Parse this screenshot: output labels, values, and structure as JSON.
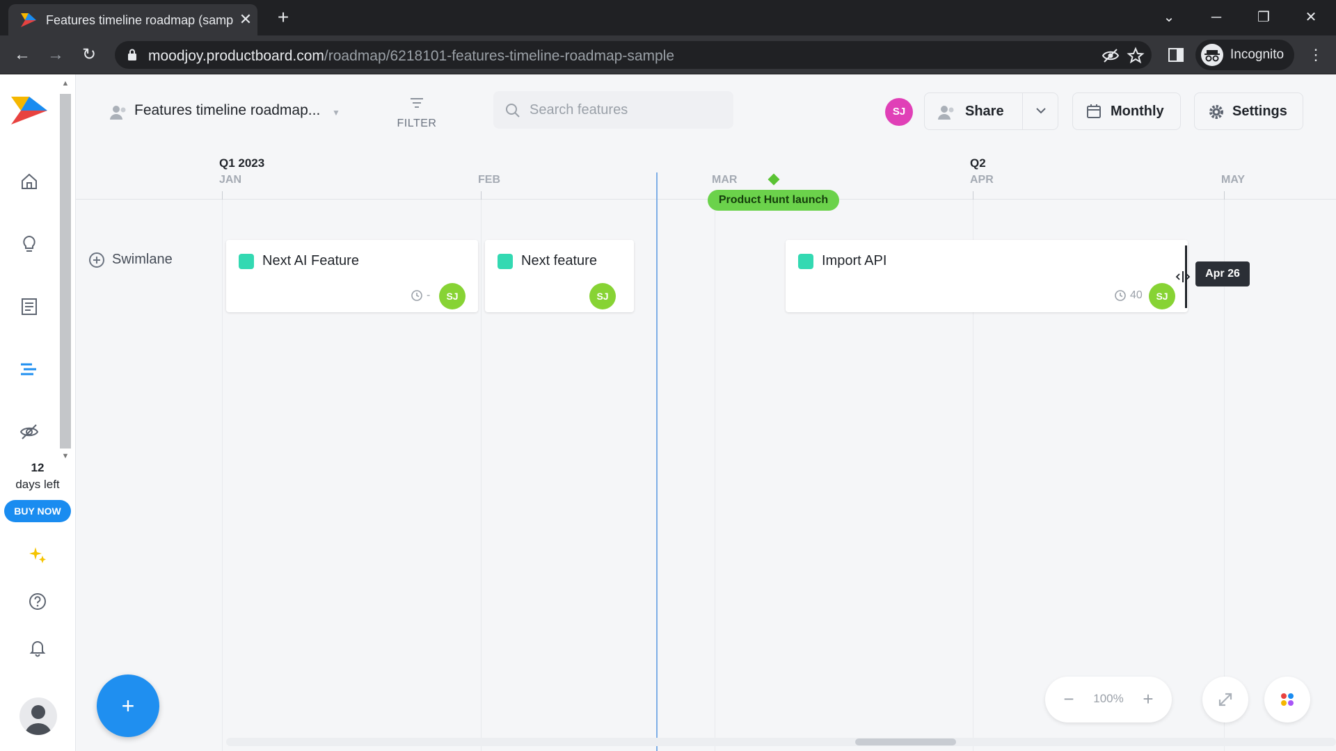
{
  "browser": {
    "tab_title": "Features timeline roadmap (sample)",
    "url_host": "moodjoy.productboard.com",
    "url_path": "/roadmap/6218101-features-timeline-roadmap-sample",
    "profile_label": "Incognito"
  },
  "sidebar": {
    "trial_days": "12",
    "trial_label": "days left",
    "buy_label": "BUY NOW",
    "icons": [
      "home-icon",
      "lightbulb-icon",
      "notes-icon",
      "roadmap-icon",
      "hidden-icon",
      "sparkle-icon",
      "help-icon",
      "bell-icon",
      "user-avatar-icon"
    ]
  },
  "header": {
    "roadmap_title": "Features timeline roadmap...",
    "filter_label": "FILTER",
    "search_placeholder": "Search features",
    "user_initials": "SJ",
    "share_label": "Share",
    "monthly_label": "Monthly",
    "settings_label": "Settings"
  },
  "timeline": {
    "quarters": [
      "Q1 2023",
      "Q2"
    ],
    "months": [
      "JAN",
      "FEB",
      "MAR",
      "APR",
      "MAY"
    ],
    "milestone": "Product Hunt launch",
    "swimlane_label": "Swimlane",
    "cards": [
      {
        "title": "Next AI Feature",
        "effort": "-",
        "initials": "SJ"
      },
      {
        "title": "Next feature",
        "initials": "SJ"
      },
      {
        "title": "Import API",
        "effort": "40",
        "initials": "SJ"
      }
    ],
    "tooltip": "Apr 26"
  },
  "controls": {
    "add_label": "+",
    "zoom_value": "100%",
    "zoom_minus": "−",
    "zoom_plus": "+"
  },
  "colors": {
    "accent_blue": "#1f8ff0",
    "milestone_green": "#6bd24b",
    "card_teal": "#33d9b2",
    "avatar_green": "#87d334",
    "user_badge_pink": "#e040b7"
  }
}
